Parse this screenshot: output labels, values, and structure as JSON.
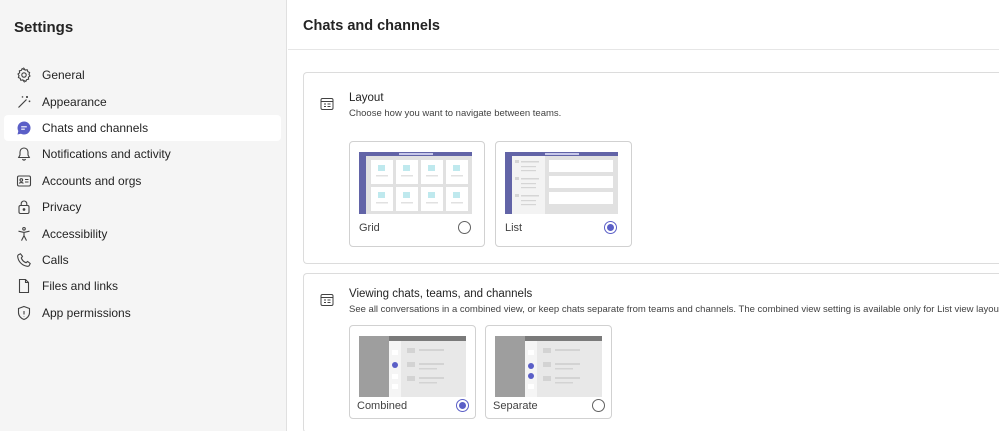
{
  "sidebar": {
    "title": "Settings",
    "items": [
      {
        "label": "General",
        "icon": "gear-icon"
      },
      {
        "label": "Appearance",
        "icon": "magic-wand-icon"
      },
      {
        "label": "Chats and channels",
        "icon": "chat-bubble-icon",
        "active": true
      },
      {
        "label": "Notifications and activity",
        "icon": "bell-icon"
      },
      {
        "label": "Accounts and orgs",
        "icon": "id-card-icon"
      },
      {
        "label": "Privacy",
        "icon": "lock-icon"
      },
      {
        "label": "Accessibility",
        "icon": "accessibility-icon"
      },
      {
        "label": "Calls",
        "icon": "phone-icon"
      },
      {
        "label": "Files and links",
        "icon": "document-icon"
      },
      {
        "label": "App permissions",
        "icon": "shield-icon"
      }
    ]
  },
  "main": {
    "title": "Chats and channels",
    "layout": {
      "title": "Layout",
      "description": "Choose how you want to navigate between teams.",
      "options": [
        {
          "label": "Grid",
          "selected": false
        },
        {
          "label": "List",
          "selected": true
        }
      ]
    },
    "viewing": {
      "title": "Viewing chats, teams, and channels",
      "description": "See all conversations in a combined view, or keep chats separate from teams and channels. The combined view setting is available only for List view layout.",
      "options": [
        {
          "label": "Combined",
          "selected": true
        },
        {
          "label": "Separate",
          "selected": false
        }
      ]
    }
  },
  "colors": {
    "accent": "#5b5fc7",
    "sidebar_bg": "#f5f5f5",
    "thumb_bar": "#6264a7"
  }
}
